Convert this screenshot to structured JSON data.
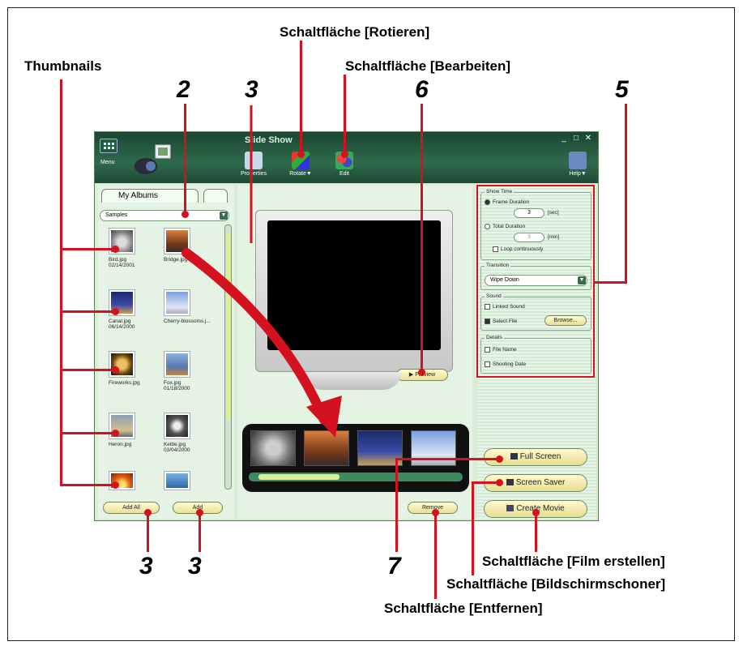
{
  "callouts": {
    "rotate_button": "Schaltfläche [Rotieren]",
    "edit_button": "Schaltfläche [Bearbeiten]",
    "thumbnails": "Thumbnails",
    "create_movie_button": "Schaltfläche [Film erstellen]",
    "screensaver_button": "Schaltfläche [Bildschirmschoner]",
    "remove_button": "Schaltfläche [Entfernen]"
  },
  "numbers": {
    "n2": "2",
    "n3_top": "3",
    "n6": "6",
    "n5": "5",
    "n3_left": "3",
    "n3_right": "3",
    "n7": "7"
  },
  "app": {
    "title": "Slide Show",
    "menu_label": "Menu",
    "toolbar": {
      "properties": "Properties",
      "rotate": "Rotate▼",
      "edit": "Edit",
      "help": "Help▼"
    },
    "window_buttons": [
      "_",
      "□",
      "✕"
    ]
  },
  "left": {
    "tab_albums": "My Albums",
    "combo_value": "Samples",
    "thumbnails": [
      {
        "name": "Bird.jpg",
        "date": "02/14/2001"
      },
      {
        "name": "Bridge.jpg",
        "date": ""
      },
      {
        "name": "Canal.jpg",
        "date": "06/14/2000"
      },
      {
        "name": "Cherry-blossoms.j...",
        "date": ""
      },
      {
        "name": "Fireworks.jpg",
        "date": ""
      },
      {
        "name": "Fox.jpg",
        "date": "01/18/2000"
      },
      {
        "name": "Heron.jpg",
        "date": ""
      },
      {
        "name": "Kettle.jpg",
        "date": "03/04/2000"
      },
      {
        "name": "",
        "date": ""
      },
      {
        "name": "",
        "date": ""
      }
    ],
    "add_all": "Add All",
    "add": "Add"
  },
  "center": {
    "preview": "▶ Preview",
    "remove": "Remove"
  },
  "right": {
    "show_time": "Show Time",
    "frame_duration": "Frame Duration",
    "frame_value": "3",
    "frame_unit": "[sec]",
    "total_duration": "Total Duration",
    "total_value": "3",
    "total_unit": "[min]",
    "loop": "Loop continuously",
    "transition": "Transition",
    "transition_value": "Wipe Down",
    "sound": "Sound",
    "linked_sound": "Linked Sound",
    "select_file": "Select File",
    "browse": "Browse...",
    "details": "Details",
    "file_name": "File Name",
    "shooting_date": "Shooting Date",
    "full_screen": "Full Screen",
    "screen_saver": "Screen Saver",
    "create_movie": "Create Movie"
  },
  "colors": {
    "callout_red": "#d4111e",
    "window_green": "#2f6a4c",
    "panel_bg": "#e4f3e4",
    "button_yellow": "#fffbd0"
  }
}
